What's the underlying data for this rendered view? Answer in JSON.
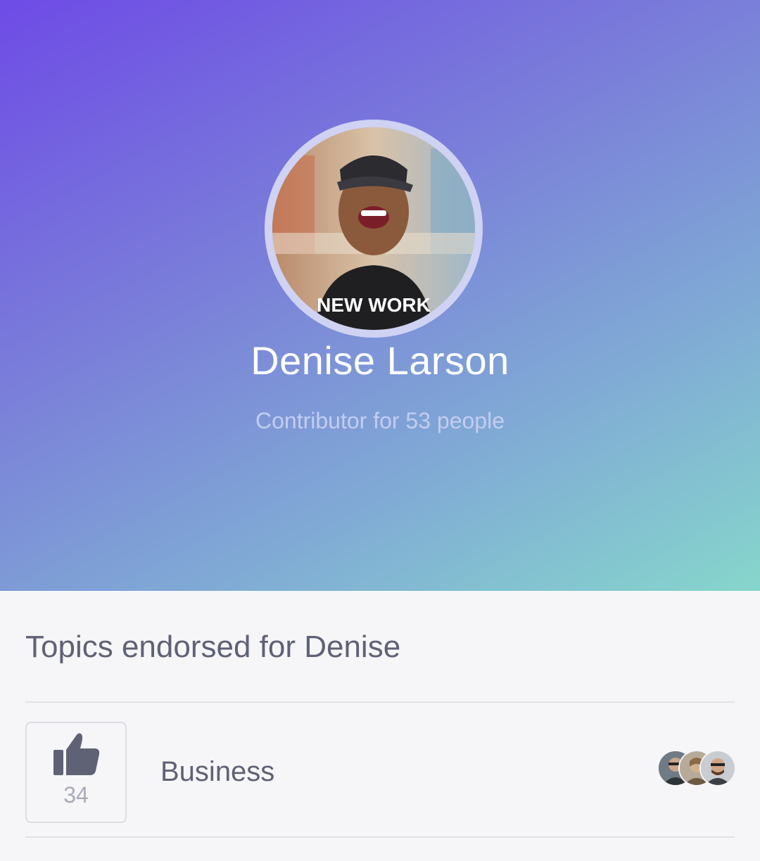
{
  "profile": {
    "name": "Denise Larson",
    "subtitle": "Contributor for 53 people",
    "avatar_shirt_text": "NEW WORK"
  },
  "topics": {
    "title": "Topics endorsed for Denise",
    "items": [
      {
        "label": "Business",
        "count": "34",
        "icon": "thumbs-up-icon"
      }
    ]
  },
  "colors": {
    "gradient_start": "#6e4be6",
    "gradient_end": "#86d6cc",
    "text_dark": "#5f6275",
    "text_muted": "#a9abb8",
    "icon": "#5f6275"
  }
}
